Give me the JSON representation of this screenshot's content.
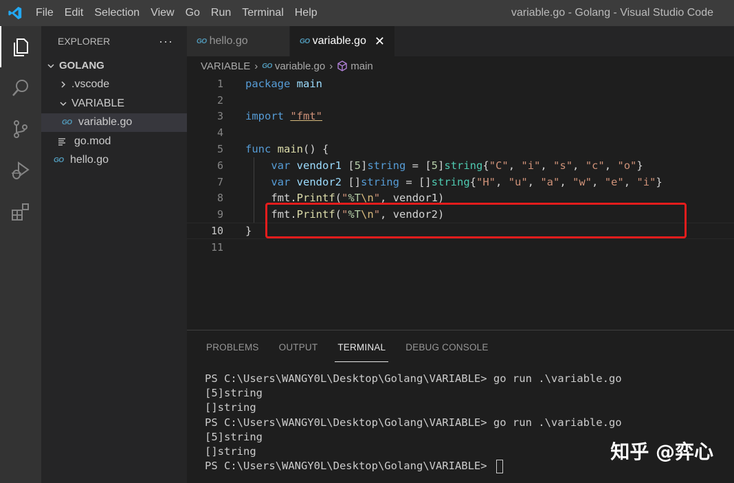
{
  "titlebar": {
    "menu": [
      "File",
      "Edit",
      "Selection",
      "View",
      "Go",
      "Run",
      "Terminal",
      "Help"
    ],
    "window_title": "variable.go - Golang - Visual Studio Code"
  },
  "activity_bar": [
    "explorer-icon",
    "search-icon",
    "source-control-icon",
    "run-debug-icon",
    "extensions-icon"
  ],
  "sidebar": {
    "header": "EXPLORER",
    "more": "···",
    "root": "GOLANG",
    "items": [
      {
        "label": ".vscode",
        "type": "folder",
        "expanded": false
      },
      {
        "label": "VARIABLE",
        "type": "folder",
        "expanded": true
      },
      {
        "label": "variable.go",
        "type": "go-file",
        "selected": true
      },
      {
        "label": "go.mod",
        "type": "mod-file"
      },
      {
        "label": "hello.go",
        "type": "go-file"
      }
    ]
  },
  "tabs": [
    {
      "label": "hello.go",
      "active": false
    },
    {
      "label": "variable.go",
      "active": true
    }
  ],
  "go_badge": "GO",
  "close_glyph": "✕",
  "breadcrumb": {
    "folder": "VARIABLE",
    "file": "variable.go",
    "symbol": "main"
  },
  "code": {
    "line_numbers": [
      "1",
      "2",
      "3",
      "4",
      "5",
      "6",
      "7",
      "8",
      "9",
      "10",
      "11"
    ],
    "current_line": 10,
    "lines": [
      [
        {
          "t": "package",
          "c": "kw"
        },
        {
          "t": " main",
          "c": "pkg"
        }
      ],
      [],
      [
        {
          "t": "import",
          "c": "kw"
        },
        {
          "t": " ",
          "c": "plain"
        },
        {
          "t": "\"fmt\"",
          "c": "str"
        }
      ],
      [],
      [
        {
          "t": "func",
          "c": "kw"
        },
        {
          "t": " ",
          "c": "plain"
        },
        {
          "t": "main",
          "c": "fn"
        },
        {
          "t": "() {",
          "c": "plain"
        }
      ],
      [
        {
          "t": "    ",
          "c": "plain"
        },
        {
          "t": "var",
          "c": "kw"
        },
        {
          "t": " vendor1",
          "c": "pkg"
        },
        {
          "t": " [",
          "c": "plain"
        },
        {
          "t": "5",
          "c": "num"
        },
        {
          "t": "]",
          "c": "plain"
        },
        {
          "t": "string",
          "c": "kw"
        },
        {
          "t": " = [",
          "c": "plain"
        },
        {
          "t": "5",
          "c": "num"
        },
        {
          "t": "]",
          "c": "plain"
        },
        {
          "t": "string",
          "c": "ty"
        },
        {
          "t": "{",
          "c": "plain"
        },
        {
          "t": "\"C\"",
          "c": "str"
        },
        {
          "t": ", ",
          "c": "plain"
        },
        {
          "t": "\"i\"",
          "c": "str"
        },
        {
          "t": ", ",
          "c": "plain"
        },
        {
          "t": "\"s\"",
          "c": "str"
        },
        {
          "t": ", ",
          "c": "plain"
        },
        {
          "t": "\"c\"",
          "c": "str"
        },
        {
          "t": ", ",
          "c": "plain"
        },
        {
          "t": "\"o\"",
          "c": "str"
        },
        {
          "t": "}",
          "c": "plain"
        }
      ],
      [
        {
          "t": "    ",
          "c": "plain"
        },
        {
          "t": "var",
          "c": "kw"
        },
        {
          "t": " vendor2",
          "c": "pkg"
        },
        {
          "t": " []",
          "c": "plain"
        },
        {
          "t": "string",
          "c": "kw"
        },
        {
          "t": " = []",
          "c": "plain"
        },
        {
          "t": "string",
          "c": "ty"
        },
        {
          "t": "{",
          "c": "plain"
        },
        {
          "t": "\"H\"",
          "c": "str"
        },
        {
          "t": ", ",
          "c": "plain"
        },
        {
          "t": "\"u\"",
          "c": "str"
        },
        {
          "t": ", ",
          "c": "plain"
        },
        {
          "t": "\"a\"",
          "c": "str"
        },
        {
          "t": ", ",
          "c": "plain"
        },
        {
          "t": "\"w\"",
          "c": "str"
        },
        {
          "t": ", ",
          "c": "plain"
        },
        {
          "t": "\"e\"",
          "c": "str"
        },
        {
          "t": ", ",
          "c": "plain"
        },
        {
          "t": "\"i\"",
          "c": "str"
        },
        {
          "t": "}",
          "c": "plain"
        }
      ],
      [
        {
          "t": "    fmt.",
          "c": "plain"
        },
        {
          "t": "Printf",
          "c": "fn"
        },
        {
          "t": "(",
          "c": "plain"
        },
        {
          "t": "\"",
          "c": "str"
        },
        {
          "t": "%T",
          "c": "num"
        },
        {
          "t": "\\n",
          "c": "esc"
        },
        {
          "t": "\"",
          "c": "str"
        },
        {
          "t": ", vendor1)",
          "c": "plain"
        }
      ],
      [
        {
          "t": "    fmt.",
          "c": "plain"
        },
        {
          "t": "Printf",
          "c": "fn"
        },
        {
          "t": "(",
          "c": "plain"
        },
        {
          "t": "\"",
          "c": "str"
        },
        {
          "t": "%T",
          "c": "num"
        },
        {
          "t": "\\n",
          "c": "esc"
        },
        {
          "t": "\"",
          "c": "str"
        },
        {
          "t": ", vendor2)",
          "c": "plain"
        }
      ],
      [
        {
          "t": "}",
          "c": "plain"
        }
      ],
      []
    ]
  },
  "panel": {
    "tabs": [
      "PROBLEMS",
      "OUTPUT",
      "TERMINAL",
      "DEBUG CONSOLE"
    ],
    "active_tab": "TERMINAL",
    "terminal_lines": [
      "PS C:\\Users\\WANGY0L\\Desktop\\Golang\\VARIABLE> go run .\\variable.go",
      "[5]string",
      "[]string",
      "PS C:\\Users\\WANGY0L\\Desktop\\Golang\\VARIABLE> go run .\\variable.go",
      "[5]string",
      "[]string",
      "PS C:\\Users\\WANGY0L\\Desktop\\Golang\\VARIABLE> "
    ]
  },
  "watermark": "知乎 @弈心",
  "colors": {
    "highlight_box": "#e51c1c",
    "accent": "#007acc"
  }
}
